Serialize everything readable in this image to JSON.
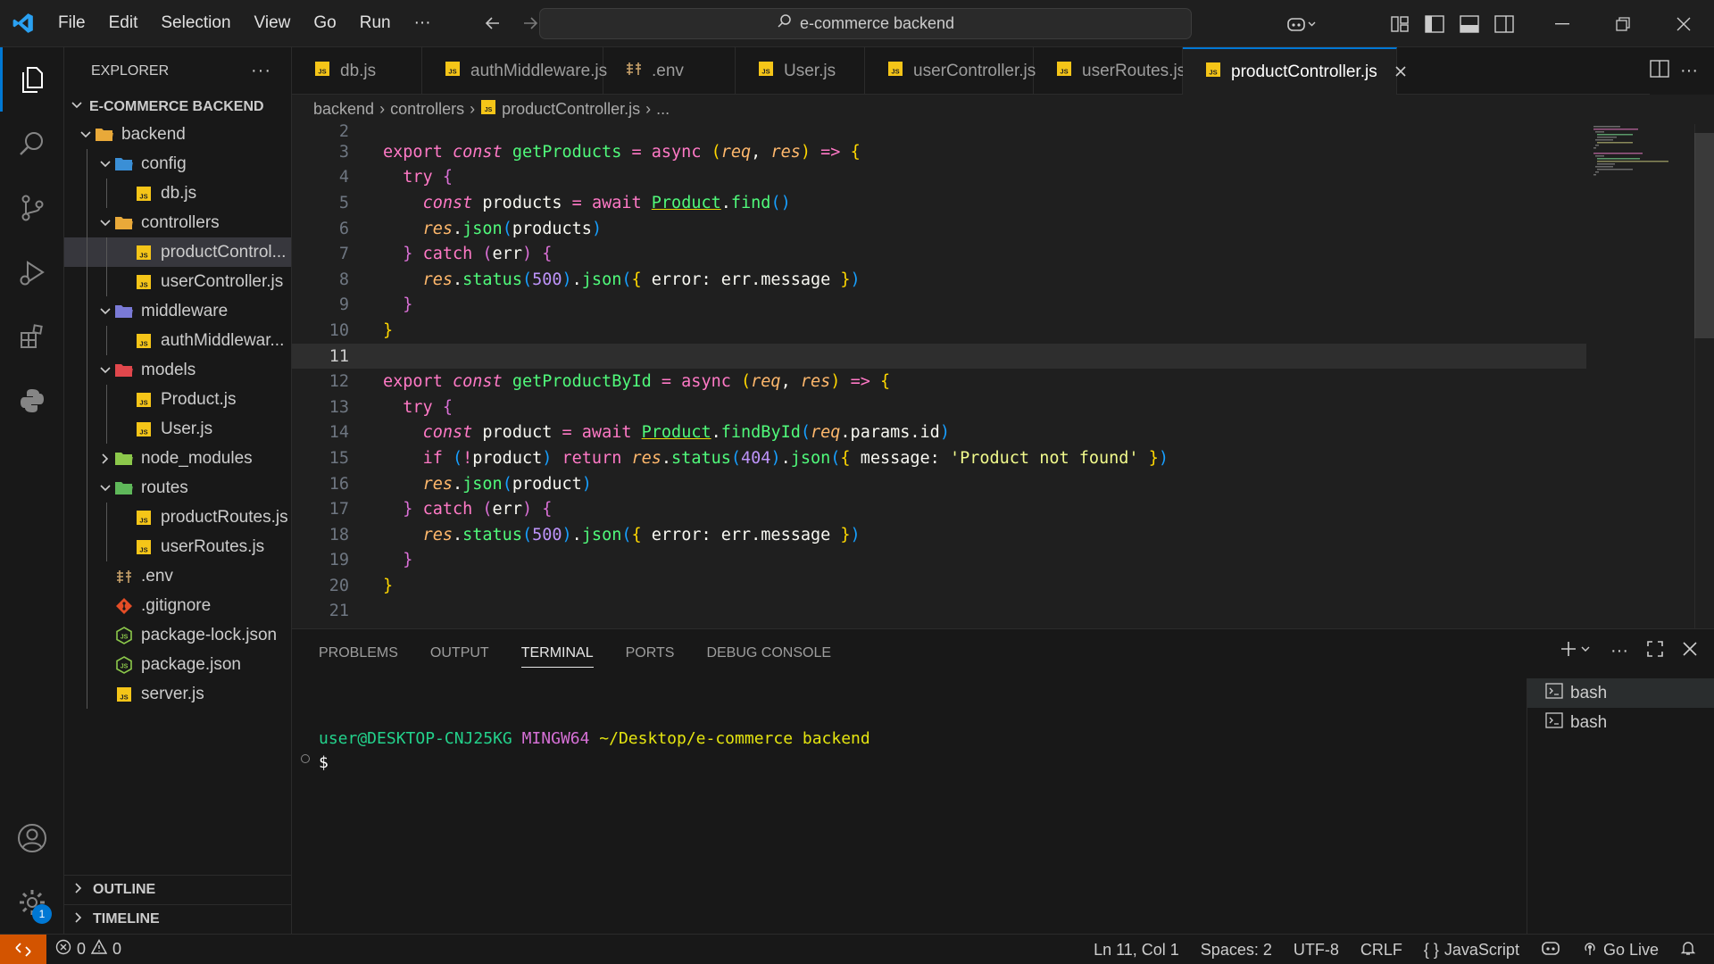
{
  "titlebar": {
    "menu": [
      "File",
      "Edit",
      "Selection",
      "View",
      "Go",
      "Run",
      "···"
    ],
    "search": "e-commerce backend"
  },
  "explorer": {
    "title": "EXPLORER",
    "root": "E-COMMERCE BACKEND",
    "tree": [
      {
        "label": "backend",
        "depth": 0,
        "type": "folder",
        "open": true,
        "icon": "folder-open-icon"
      },
      {
        "label": "config",
        "depth": 1,
        "type": "folder",
        "open": true,
        "icon": "config-folder-icon"
      },
      {
        "label": "db.js",
        "depth": 2,
        "type": "js"
      },
      {
        "label": "controllers",
        "depth": 1,
        "type": "folder",
        "open": true,
        "icon": "folder-open-icon"
      },
      {
        "label": "productControl...",
        "depth": 2,
        "type": "js",
        "selected": true
      },
      {
        "label": "userController.js",
        "depth": 2,
        "type": "js"
      },
      {
        "label": "middleware",
        "depth": 1,
        "type": "folder",
        "open": true,
        "icon": "middleware-folder-icon"
      },
      {
        "label": "authMiddlewar...",
        "depth": 2,
        "type": "js"
      },
      {
        "label": "models",
        "depth": 1,
        "type": "folder",
        "open": true,
        "icon": "models-folder-icon"
      },
      {
        "label": "Product.js",
        "depth": 2,
        "type": "js"
      },
      {
        "label": "User.js",
        "depth": 2,
        "type": "js"
      },
      {
        "label": "node_modules",
        "depth": 1,
        "type": "folder",
        "open": false,
        "icon": "node-folder-icon"
      },
      {
        "label": "routes",
        "depth": 1,
        "type": "folder",
        "open": true,
        "icon": "routes-folder-icon"
      },
      {
        "label": "productRoutes.js",
        "depth": 2,
        "type": "js"
      },
      {
        "label": "userRoutes.js",
        "depth": 2,
        "type": "js"
      },
      {
        "label": ".env",
        "depth": 1,
        "type": "env"
      },
      {
        "label": ".gitignore",
        "depth": 1,
        "type": "git"
      },
      {
        "label": "package-lock.json",
        "depth": 1,
        "type": "json"
      },
      {
        "label": "package.json",
        "depth": 1,
        "type": "json"
      },
      {
        "label": "server.js",
        "depth": 1,
        "type": "js"
      }
    ],
    "sections": [
      "OUTLINE",
      "TIMELINE"
    ]
  },
  "tabs": [
    {
      "label": "db.js",
      "type": "js"
    },
    {
      "label": "authMiddleware.js",
      "type": "js"
    },
    {
      "label": ".env",
      "type": "env"
    },
    {
      "label": "User.js",
      "type": "js"
    },
    {
      "label": "userController.js",
      "type": "js"
    },
    {
      "label": "userRoutes.js",
      "type": "js"
    },
    {
      "label": "productController.js",
      "type": "js",
      "active": true
    }
  ],
  "breadcrumb": [
    "backend",
    "controllers",
    "productController.js",
    "..."
  ],
  "editor": {
    "current_line": 11,
    "line_numbers": [
      "2",
      "3",
      "4",
      "5",
      "6",
      "7",
      "8",
      "9",
      "10",
      "11",
      "12",
      "13",
      "14",
      "15",
      "16",
      "17",
      "18",
      "19",
      "20",
      "21"
    ]
  },
  "panel": {
    "tabs": [
      "PROBLEMS",
      "OUTPUT",
      "TERMINAL",
      "PORTS",
      "DEBUG CONSOLE"
    ],
    "active_tab": "TERMINAL",
    "terminal": {
      "user_host": "user@DESKTOP-CNJ25KG",
      "shell": "MINGW64",
      "path": "~/Desktop/e-commerce backend",
      "prompt": "$"
    },
    "terminals": [
      "bash",
      "bash"
    ]
  },
  "statusbar": {
    "errors": "0",
    "warnings": "0",
    "position": "Ln 11, Col 1",
    "spaces": "Spaces: 2",
    "encoding": "UTF-8",
    "eol": "CRLF",
    "language": "JavaScript",
    "golive": "Go Live"
  },
  "activity_badge": "1",
  "colors": {
    "accent": "#0078d4",
    "remote": "#d35400",
    "js_icon": "#f5c518"
  }
}
